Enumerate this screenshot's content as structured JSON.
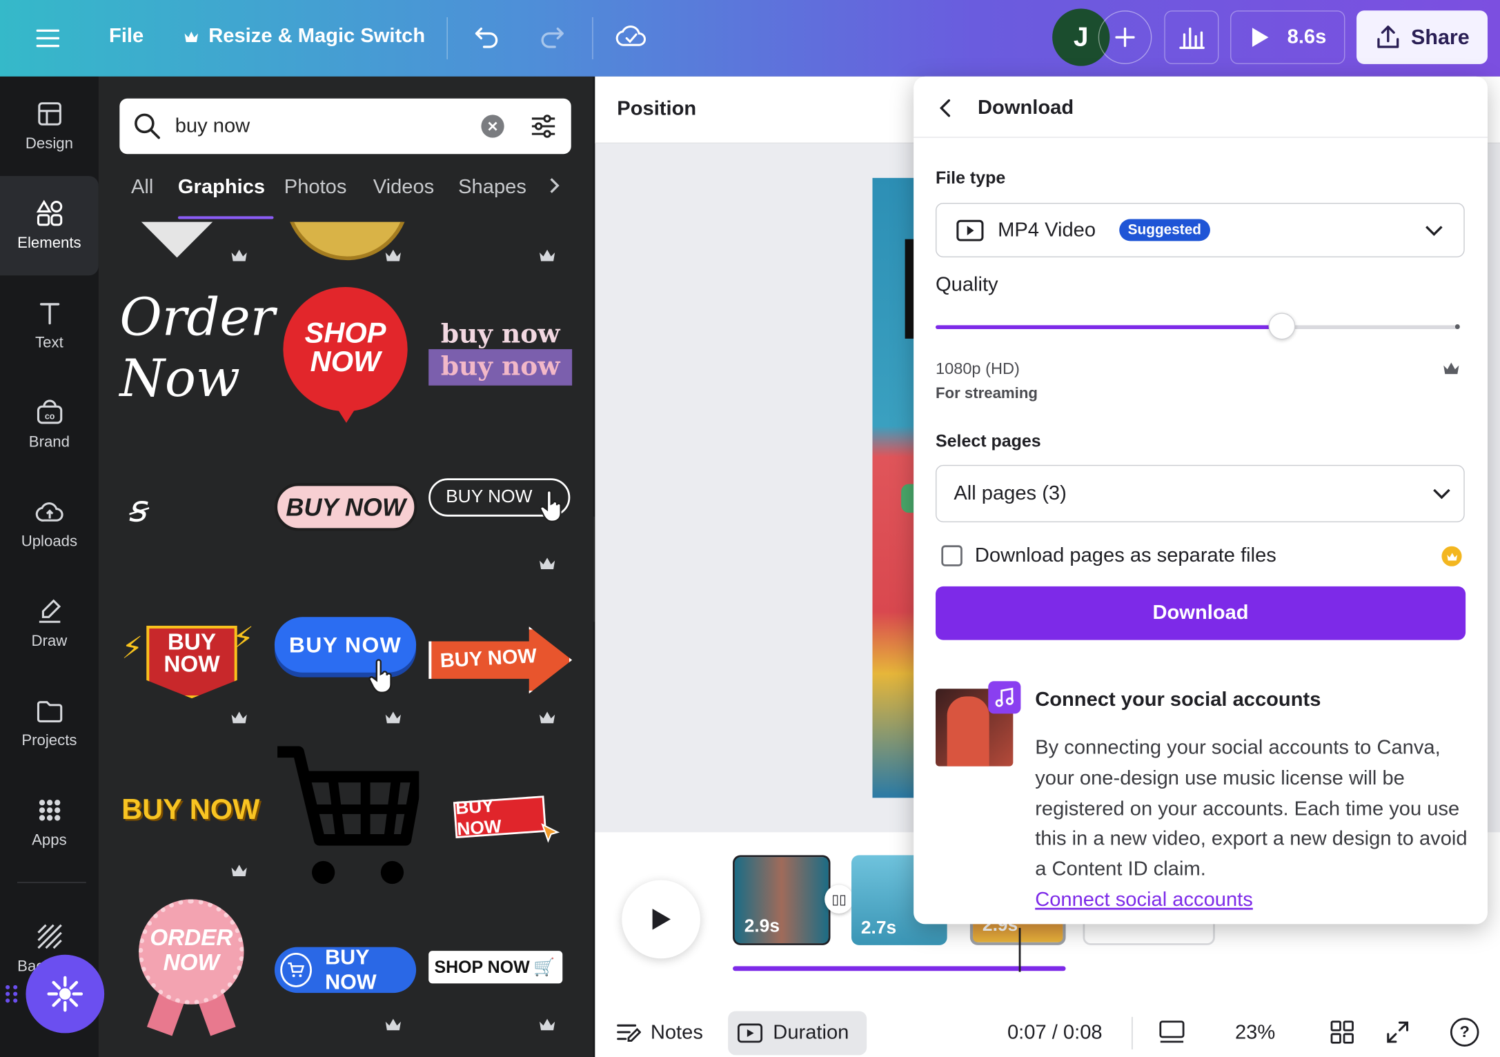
{
  "topbar": {
    "menu_icon": "hamburger-icon",
    "file_label": "File",
    "resize_label": "Resize & Magic Switch",
    "avatar_initial": "J",
    "play_duration": "8.6s",
    "share_label": "Share"
  },
  "rail": {
    "items": [
      {
        "label": "Design",
        "icon": "design-icon"
      },
      {
        "label": "Elements",
        "icon": "elements-icon"
      },
      {
        "label": "Text",
        "icon": "text-icon"
      },
      {
        "label": "Brand",
        "icon": "brand-icon"
      },
      {
        "label": "Uploads",
        "icon": "uploads-icon"
      },
      {
        "label": "Draw",
        "icon": "draw-icon"
      },
      {
        "label": "Projects",
        "icon": "projects-icon"
      },
      {
        "label": "Apps",
        "icon": "apps-icon"
      },
      {
        "label": "Backg...d",
        "icon": "background-icon"
      }
    ]
  },
  "panel": {
    "search_value": "buy now",
    "tabs": [
      "All",
      "Graphics",
      "Photos",
      "Videos",
      "Shapes"
    ],
    "active_tab": "Graphics",
    "graphics": {
      "order_now_script": "Order Now",
      "shop_now_bubble": [
        "SHOP",
        "NOW"
      ],
      "buy_now_stacked": [
        "buy now",
        "buy now"
      ],
      "buy_now_pill": "BUY NOW",
      "buy_now_outline": "BUY NOW",
      "buy_now_burst": [
        "BUY",
        "NOW"
      ],
      "buy_now_blue": "BUY NOW",
      "buy_now_arrow": "BUY NOW",
      "buy_now_yellow": "BUY NOW",
      "buy_now_red_tag": "BUY NOW",
      "order_now_badge": [
        "ORDER",
        "NOW"
      ],
      "buy_now_cart_button": "BUY NOW",
      "shop_now_cart": "SHOP NOW"
    }
  },
  "canvas": {
    "toolbar_label": "Position",
    "clips": [
      {
        "duration": "2.9s"
      },
      {
        "duration": "2.7s"
      },
      {
        "duration": "2.9s"
      }
    ],
    "notes_label": "Notes",
    "duration_label": "Duration",
    "time": "0:07 / 0:08",
    "zoom": "23%"
  },
  "download": {
    "title": "Download",
    "file_type_label": "File type",
    "file_type_value": "MP4 Video",
    "file_type_badge": "Suggested",
    "quality_label": "Quality",
    "quality_level": 0.66,
    "quality_value": "1080p (HD)",
    "quality_hint": "For streaming",
    "pages_label": "Select pages",
    "pages_value": "All pages (3)",
    "separate_files_label": "Download pages as separate files",
    "separate_files_checked": false,
    "button_label": "Download",
    "social_title": "Connect your social accounts",
    "social_text": "By connecting your social accounts to Canva, your one-design use music license will be registered on your accounts. Each time you use this in a new video, export a new design to avoid a Content ID claim.",
    "social_link": "Connect social accounts"
  },
  "colors": {
    "accent": "#7d2ae8",
    "badge": "#1f55d6",
    "rail_bg": "#18191b",
    "panel_bg": "#252627"
  }
}
